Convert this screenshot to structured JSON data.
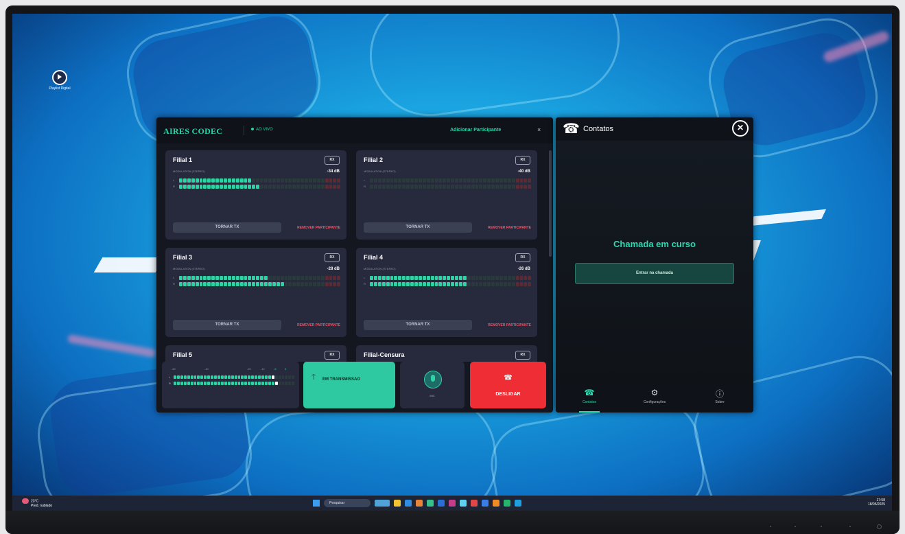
{
  "desktop": {
    "icon_label": "Playlist Digital"
  },
  "codec": {
    "title": "AIRES CODEC",
    "live_label": "AO VIVO",
    "add_participant": "Adicionar Participante",
    "close": "×",
    "labels": {
      "modulation": "MODULATION (STEREO)",
      "left_channel": "L",
      "right_channel": "R",
      "rx": "RX",
      "make_tx": "TORNAR TX",
      "remove": "REMOVER PARTICIPANTE"
    },
    "participants": [
      {
        "name": "Filial 1",
        "db": "-34 dB",
        "level_l": 0.45,
        "level_r": 0.5
      },
      {
        "name": "Filial 2",
        "db": "-40 dB",
        "level_l": 0.0,
        "level_r": 0.0
      },
      {
        "name": "Filial 3",
        "db": "-28 dB",
        "level_l": 0.55,
        "level_r": 0.65
      },
      {
        "name": "Filial 4",
        "db": "-26 dB",
        "level_l": 0.6,
        "level_r": 0.6
      },
      {
        "name": "Filial 5"
      },
      {
        "name": "Filial-Censura"
      }
    ],
    "master_meter": {
      "scale": [
        "-60",
        "-40",
        "-20",
        "-12",
        "-6",
        "0"
      ],
      "level_l": 0.82,
      "level_r": 0.86
    },
    "controls": {
      "transmission_label": "EM TRANSMISSAO",
      "mic_label": "MIC",
      "hangup_label": "DESLIGAR"
    }
  },
  "contacts": {
    "title": "Contatos",
    "call_status": "Chamada em curso",
    "join_button": "Entrar na chamada",
    "nav": [
      {
        "label": "Contatos",
        "icon": "phone-icon",
        "active": true
      },
      {
        "label": "Configurações",
        "icon": "gear-icon",
        "active": false
      },
      {
        "label": "Sobre",
        "icon": "info-icon",
        "active": false
      }
    ]
  },
  "taskbar": {
    "weather_temp": "23°C",
    "weather_desc": "Pred. nublado",
    "search_placeholder": "Pesquisar",
    "time": "17:58",
    "date": "18/05/2025"
  },
  "colors": {
    "accent": "#2bd9b0",
    "danger": "#ee2d34",
    "panel": "#272a3d",
    "window_bg": "#151720"
  }
}
